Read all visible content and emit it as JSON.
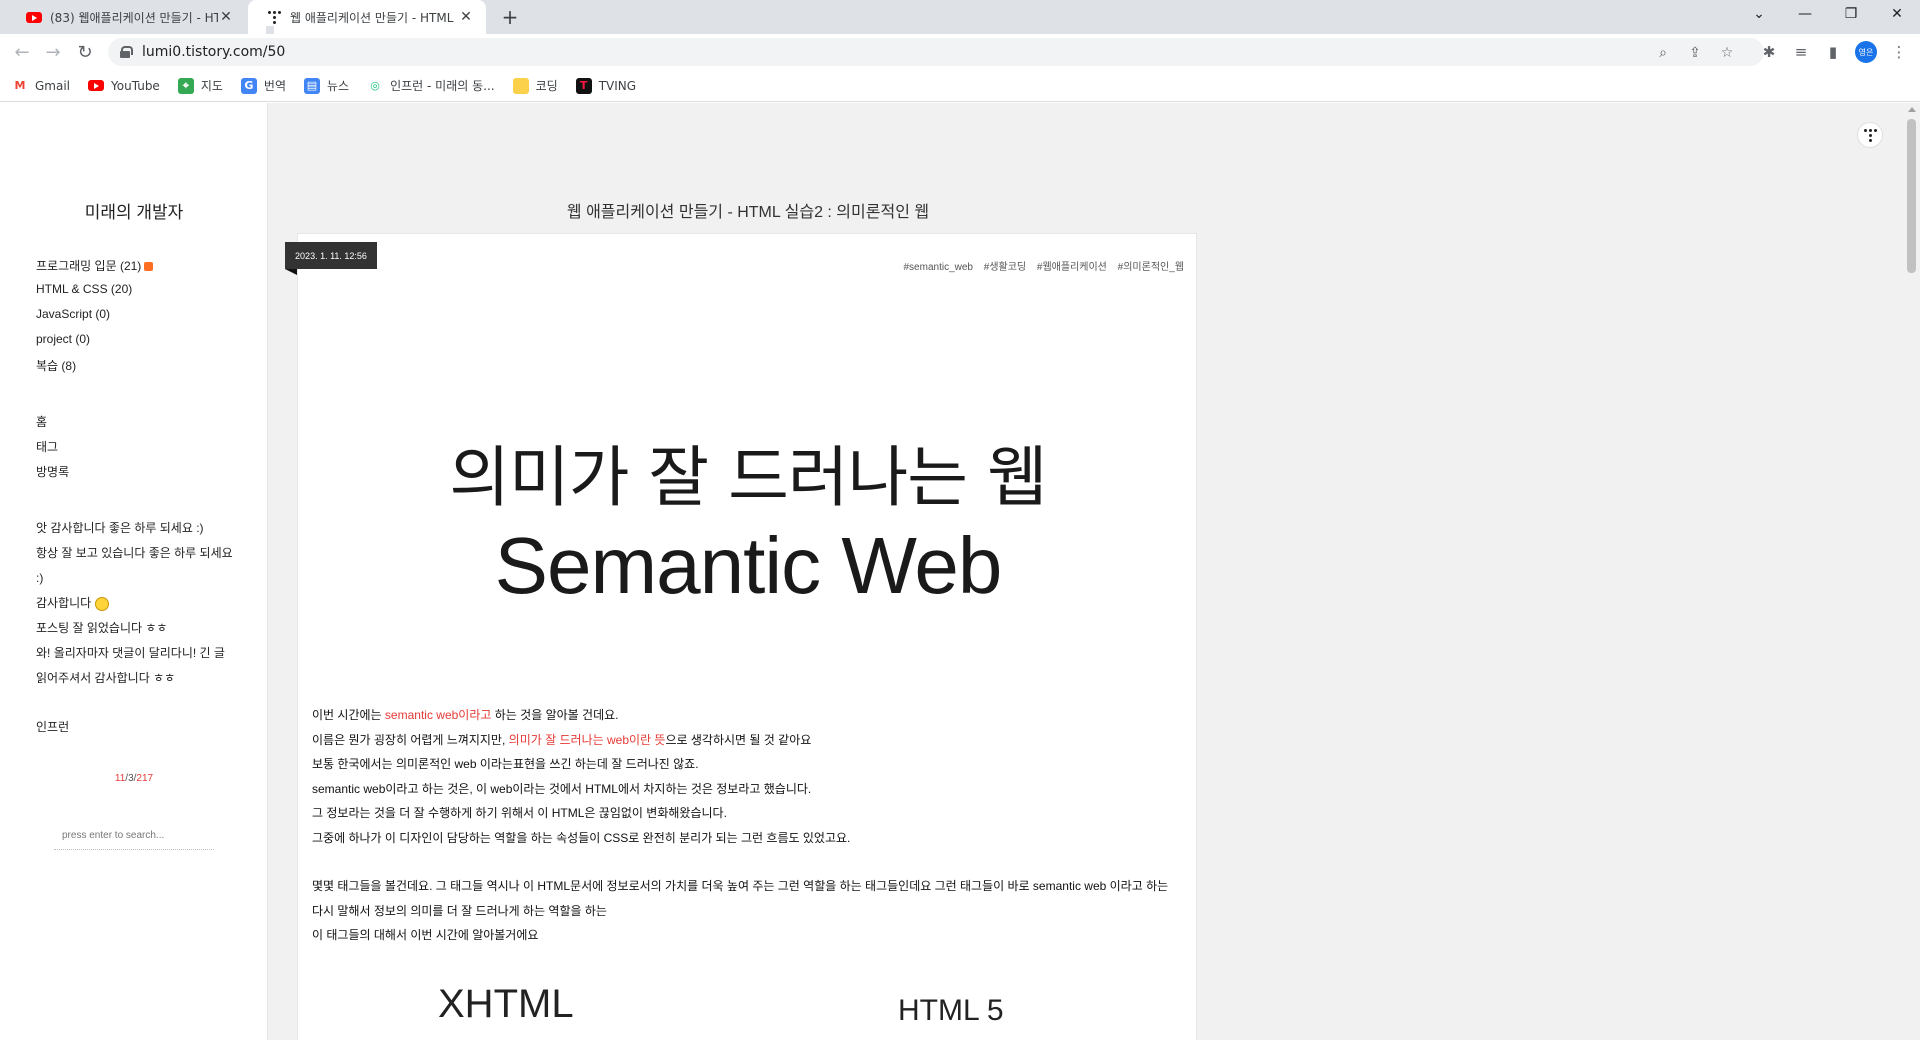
{
  "tabs": [
    {
      "title": "(83) 웹애플리케이션 만들기 - HTM",
      "favicon": "youtube-icon",
      "active": false
    },
    {
      "title": "웹 애플리케이션 만들기 - HTML",
      "favicon": "tistory-icon",
      "active": true
    }
  ],
  "window": {
    "chevron": "⌄",
    "minimize": "—",
    "restore": "❐",
    "close": "✕"
  },
  "address": {
    "url": "lumi0.tistory.com/50"
  },
  "profile": {
    "initials": "영은",
    "color": "#1a73e8"
  },
  "bookmarks": [
    {
      "label": "Gmail",
      "icon": "gmail-icon"
    },
    {
      "label": "YouTube",
      "icon": "youtube-icon"
    },
    {
      "label": "지도",
      "icon": "maps-icon"
    },
    {
      "label": "번역",
      "icon": "translate-icon"
    },
    {
      "label": "뉴스",
      "icon": "news-icon"
    },
    {
      "label": "인프런 - 미래의 동...",
      "icon": "inflearn-icon"
    },
    {
      "label": "코딩",
      "icon": "folder-icon"
    },
    {
      "label": "TVING",
      "icon": "tving-icon"
    }
  ],
  "sidebar": {
    "blog_title": "미래의 개발자",
    "categories": [
      "프로그래밍 입문 (21)",
      "HTML & CSS (20)",
      "JavaScript (0)",
      "project (0)",
      "복습 (8)"
    ],
    "menu": [
      "홈",
      "태그",
      "방명록"
    ],
    "recent_comments": [
      "앗 감사합니다 좋은 하루 되세요 :)",
      "항상 잘 보고 있습니다 좋은 하루 되세요 :)",
      "감사합니다",
      "포스팅 잘 읽었습니다 ㅎㅎ",
      "와! 올리자마자 댓글이 달리다니! 긴 글 읽어주셔서 감사합니다 ㅎㅎ"
    ],
    "links": [
      "인프런"
    ],
    "counter": {
      "total": "11",
      "sep1": "/",
      "today": "3",
      "sep2": "/",
      "yesterday": "217"
    },
    "search_placeholder": "press enter to search..."
  },
  "post": {
    "title": "웹 애플리케이션 만들기 - HTML 실습2 : 의미론적인 웹",
    "date": "2023. 1. 11. 12:56",
    "tags": [
      "#semantic_web",
      "#생활코딩",
      "#웹애플리케이션",
      "#의미론적인_웹"
    ],
    "hero_line1": "의미가 잘 드러나는 웹",
    "hero_line2": "Semantic Web",
    "paragraphs": {
      "p1_a": "이번 시간에는 ",
      "p1_red": "semantic web이라고",
      "p1_b": " 하는 것을 알아볼 건데요.",
      "p2_a": "이름은 뭔가 굉장히 어렵게 느껴지지만, ",
      "p2_red": "의미가 잘 드러나는  web이란 뜻",
      "p2_b": "으로 생각하시면 될 것 같아요",
      "p3": "보통 한국에서는 의미론적인 web 이라는표현을 쓰긴 하는데 잘 드러나진 않죠.",
      "p4": "semantic web이라고 하는 것은, 이 web이라는 것에서 HTML에서 차지하는 것은 정보라고 했습니다.",
      "p5": "그 정보라는 것을 더 잘 수행하게 하기 위해서 이 HTML은 끊임없이 변화해왔습니다.",
      "p6": "그중에 하나가 이 디자인이 담당하는 역할을 하는 속성들이 CSS로 완전히 분리가 되는 그런 흐름도 있었고요.",
      "p7": "몇몇 태그들을 볼건데요. 그 태그들 역시나 이 HTML문서에 정보로서의 가치를 더욱 높여 주는 그런 역할을 하는 태그들인데요 그런 태그들이 바로 semantic web 이라고 하는 다시 말해서 정보의 의미를 더 잘 드러나게 하는 역할을 하는",
      "p8": "이 태그들의 대해서 이번 시간에 알아볼거에요"
    },
    "bottom_left_heading": "XHTML",
    "bottom_right_heading": "HTML 5"
  }
}
